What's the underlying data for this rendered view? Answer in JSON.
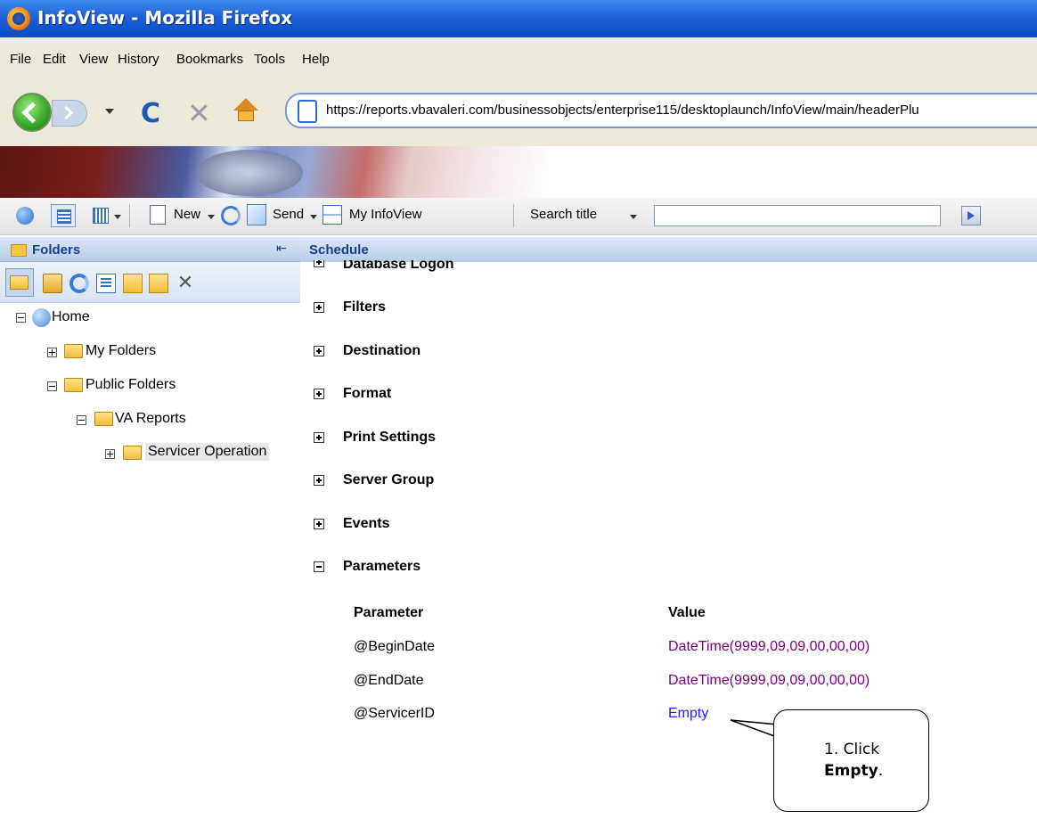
{
  "window": {
    "title": "InfoView - Mozilla Firefox"
  },
  "menu": {
    "items": [
      "File",
      "Edit",
      "View",
      "History",
      "Bookmarks",
      "Tools",
      "Help"
    ]
  },
  "nav": {
    "url": "https://reports.vbavaleri.com/businessobjects/enterprise115/desktoplaunch/InfoView/main/headerPlu"
  },
  "toolbar": {
    "new_label": "New",
    "send_label": "Send",
    "myinfoview_label": "My InfoView",
    "search_scope_label": "Search title",
    "search_value": ""
  },
  "left_panel": {
    "title": "Folders",
    "tree": {
      "home": "Home",
      "my_folders": "My Folders",
      "public_folders": "Public Folders",
      "va_reports": "VA Reports",
      "servicer_operation": "Servicer Operation"
    }
  },
  "right_panel": {
    "title": "Schedule",
    "partial_section": "Database Logon",
    "sections": [
      "Filters",
      "Destination",
      "Format",
      "Print Settings",
      "Server Group",
      "Events",
      "Parameters"
    ],
    "parameters": {
      "col_parameter": "Parameter",
      "col_value": "Value",
      "rows": [
        {
          "name": "@BeginDate",
          "value": "DateTime(9999,09,09,00,00,00)"
        },
        {
          "name": "@EndDate",
          "value": "DateTime(9999,09,09,00,00,00)"
        },
        {
          "name": "@ServicerID",
          "value": "Empty"
        }
      ]
    }
  },
  "callout": {
    "line1": "1. Click",
    "line2_bold": "Empty",
    "line2_suffix": "."
  }
}
